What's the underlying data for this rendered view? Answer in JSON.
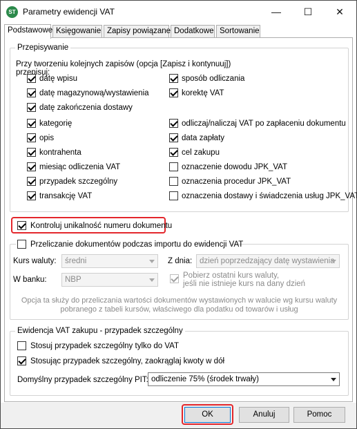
{
  "window": {
    "title": "Parametry ewidencji VAT",
    "minimize_label": "—",
    "maximize_label": "☐",
    "close_label": "✕"
  },
  "tabs": [
    {
      "label": "Podstawowe",
      "active": true
    },
    {
      "label": "Księgowanie",
      "active": false
    },
    {
      "label": "Zapisy powiązane",
      "active": false
    },
    {
      "label": "Dodatkowe",
      "active": false
    },
    {
      "label": "Sortowanie",
      "active": false
    }
  ],
  "przepisywanie": {
    "legend": "Przepisywanie",
    "intro_line1": "Przy tworzeniu kolejnych zapisów (opcja [Zapisz i kontynuuj])",
    "intro_line2": "przepisuj:",
    "left": [
      {
        "label": "datę wpisu",
        "checked": true
      },
      {
        "label": "datę magazynową/wystawienia",
        "checked": true
      },
      {
        "label": "datę zakończenia dostawy",
        "checked": true
      },
      {
        "label": "kategorię",
        "checked": true
      },
      {
        "label": "opis",
        "checked": true
      },
      {
        "label": "kontrahenta",
        "checked": true
      },
      {
        "label": "miesiąc odliczenia VAT",
        "checked": true
      },
      {
        "label": "przypadek szczególny",
        "checked": true
      },
      {
        "label": "transakcję VAT",
        "checked": true
      }
    ],
    "right": [
      {
        "label": "sposób odliczania",
        "checked": true
      },
      {
        "label": "korektę VAT",
        "checked": true
      },
      {
        "label": "odliczaj/naliczaj VAT po zapłaceniu dokumentu",
        "checked": true
      },
      {
        "label": "data zapłaty",
        "checked": true
      },
      {
        "label": "cel zakupu",
        "checked": true
      },
      {
        "label": "oznaczenie dowodu JPK_VAT",
        "checked": false
      },
      {
        "label": "oznaczenia procedur JPK_VAT",
        "checked": false
      },
      {
        "label": "oznaczenia dostawy i świadczenia usług JPK_VAT",
        "checked": false
      }
    ]
  },
  "kontroluj": {
    "label": "Kontroluj unikalność numeru dokumentu",
    "checked": true
  },
  "przeliczanie": {
    "legend": "Przeliczanie dokumentów podczas importu do ewidencji VAT",
    "checked": false,
    "kurs_label": "Kurs waluty:",
    "kurs_value": "średni",
    "bank_label": "W banku:",
    "bank_value": "NBP",
    "zdnia_label": "Z dnia:",
    "zdnia_value": "dzień poprzedzający datę wystawienia",
    "pobierz_line1": "Pobierz ostatni kurs waluty,",
    "pobierz_line2": "jeśli nie istnieje kurs na dany dzień",
    "pobierz_checked": true,
    "info_line1": "Opcja ta służy do przeliczania wartości dokumentów wystawionych w walucie wg kursu waluty",
    "info_line2": "pobranego z tabeli kursów, właściwego dla podatku od towarów i usług"
  },
  "ewidencja": {
    "legend": "Ewidencja VAT zakupu - przypadek szczególny",
    "stosuj_label": "Stosuj przypadek szczególny tylko do VAT",
    "stosuj_checked": false,
    "zaokraglaj_label": "Stosując przypadek szczególny, zaokrąglaj kwoty w dół",
    "zaokraglaj_checked": true,
    "pit_label": "Domyślny przypadek szczególny PIT:",
    "pit_value": "odliczenie 75% (środek trwały)"
  },
  "buttons": {
    "ok": "OK",
    "cancel": "Anuluj",
    "help": "Pomoc"
  },
  "colors": {
    "highlight": "#e3262b",
    "default_button_border": "#0078d7",
    "app_icon": "#2c8a4b"
  }
}
